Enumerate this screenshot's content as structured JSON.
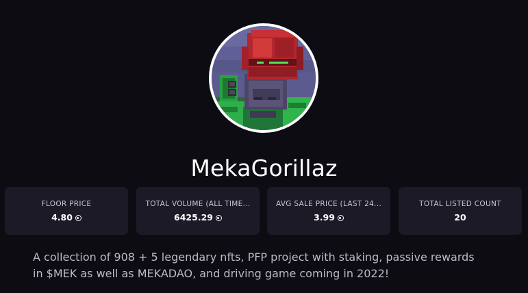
{
  "collection": {
    "name": "MekaGorillaz",
    "avatar_alt": "MekaGorillaz avatar",
    "description": "A collection of 908 + 5 legendary nfts, PFP project with staking, passive rewards in $MEK as well as MEKADAO, and driving game coming in 2022!"
  },
  "stats": [
    {
      "label": "FLOOR PRICE",
      "value": "4.80",
      "currency_icon": "coin-icon"
    },
    {
      "label": "TOTAL VOLUME (ALL TIME...",
      "value": "6425.29",
      "currency_icon": "coin-icon"
    },
    {
      "label": "AVG SALE PRICE (LAST 24...",
      "value": "3.99",
      "currency_icon": "coin-icon"
    },
    {
      "label": "TOTAL LISTED COUNT",
      "value": "20"
    }
  ],
  "theme": {
    "background": "#0e0c13",
    "card": "#1b1a26",
    "text": "#ffffff",
    "muted_text": "#bcbac6"
  }
}
